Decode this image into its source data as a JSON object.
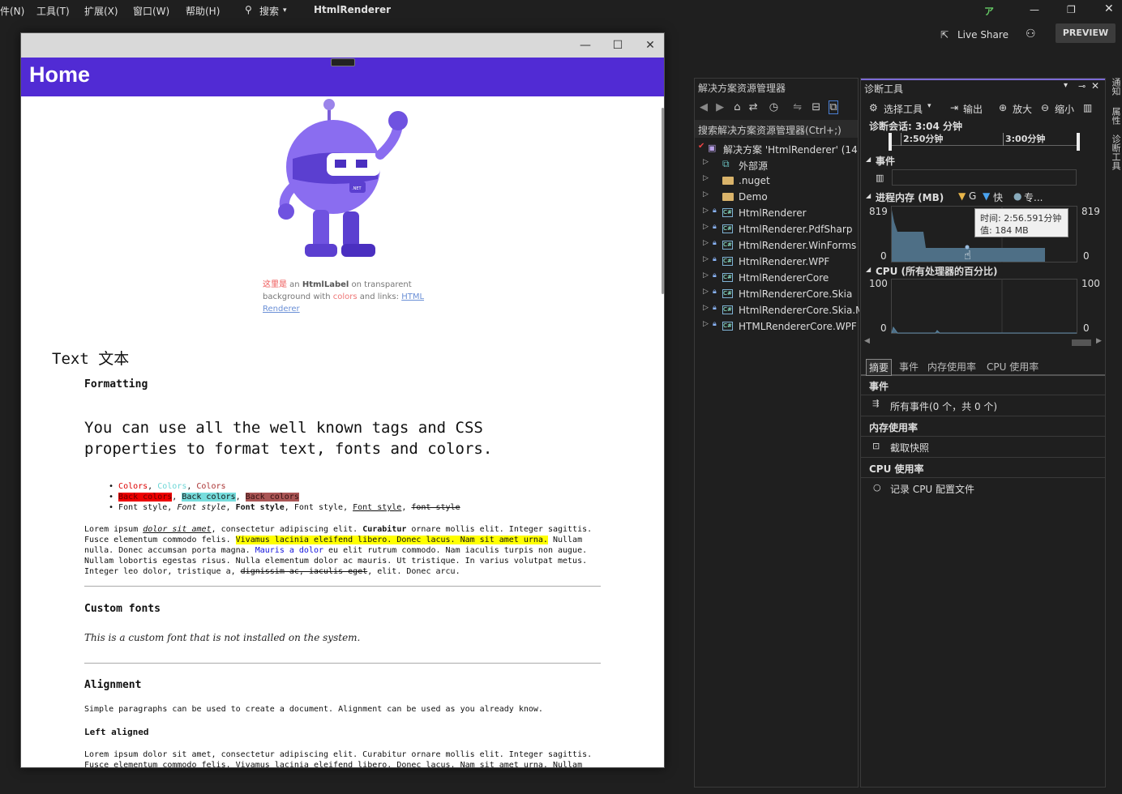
{
  "menubar": {
    "items": [
      "件(N)",
      "工具(T)",
      "扩展(X)",
      "窗口(W)",
      "帮助(H)"
    ],
    "search_label": "搜索",
    "solution_title": "HtmlRenderer",
    "live_share": "Live Share",
    "preview": "PREVIEW"
  },
  "app_window": {
    "header_title": "Home",
    "caption": {
      "colored_word": "这里是",
      "part1": " an ",
      "bold": "HtmlLabel",
      "part2": " on transparent",
      "part3": "background with ",
      "colors_word": "colors",
      "part4": " and links: ",
      "link": "HTML",
      "link2": "Renderer"
    },
    "section_text": "Text 文本",
    "formatting": "Formatting",
    "intro_line1": "You can use all the well known tags and CSS",
    "intro_line2": "properties to format text, fonts and colors.",
    "bullets": {
      "colors": [
        "Colors",
        "Colors",
        "Colors"
      ],
      "back_colors": [
        "Back colors",
        "Back colors",
        "Back colors"
      ],
      "font_styles": [
        "Font style",
        "Font style",
        "Font style",
        "Font style",
        "Font style",
        "font style"
      ]
    },
    "lorem": {
      "l1a": "Lorem ipsum ",
      "l1b": "dolor sit amet",
      "l1c": ", consectetur adipiscing elit. ",
      "l1d": "Curabitur",
      "l1e": " ornare mollis elit. Integer sagittis.",
      "l2a": "Fusce elementum commodo felis. ",
      "l2b": "Vivamus lacinia eleifend libero. Donec lacus. Nam sit amet urna.",
      "l2c": " Nullam",
      "l3a": "nulla. Donec accumsan porta magna. ",
      "l3b": "Mauris a dolor",
      "l3c": " eu elit rutrum commodo. Nam iaculis turpis non augue.",
      "l4": "Nullam lobortis egestas risus. Nulla elementum dolor ac mauris. Ut tristique. In varius volutpat metus.",
      "l5a": "Integer leo dolor, tristique a, ",
      "l5b": "dignissim ac, iaculis eget",
      "l5c": ", elit. Donec arcu."
    },
    "custom_fonts": "Custom fonts",
    "custom_font_sample": "This is a custom font that is not installed on the system.",
    "alignment": "Alignment",
    "alignment_desc": "Simple paragraphs can be used to create a document. Alignment can be used as you already know.",
    "left_aligned": "Left aligned",
    "lorem2_l1": "Lorem ipsum dolor sit amet, consectetur adipiscing elit. Curabitur ornare mollis elit. Integer sagittis.",
    "lorem2_l2": "Fusce elementum commodo felis. Vivamus lacinia eleifend libero. Donec lacus. Nam sit amet urna. Nullam"
  },
  "solution_explorer": {
    "title": "解决方案资源管理器",
    "search_placeholder": "搜索解决方案资源管理器(Ctrl+;)",
    "root": "解决方案 'HtmlRenderer' (14",
    "items": [
      {
        "label": "外部源",
        "type": "folder-ext"
      },
      {
        "label": ".nuget",
        "type": "folder"
      },
      {
        "label": "Demo",
        "type": "folder"
      },
      {
        "label": "HtmlRenderer",
        "type": "csproj"
      },
      {
        "label": "HtmlRenderer.PdfSharp",
        "type": "csproj"
      },
      {
        "label": "HtmlRenderer.WinForms",
        "type": "csproj"
      },
      {
        "label": "HtmlRenderer.WPF",
        "type": "csproj"
      },
      {
        "label": "HtmlRendererCore",
        "type": "csproj"
      },
      {
        "label": "HtmlRendererCore.Skia",
        "type": "csproj"
      },
      {
        "label": "HtmlRendererCore.Skia.M",
        "type": "csproj"
      },
      {
        "label": "HTMLRendererCore.WPF",
        "type": "csproj"
      }
    ]
  },
  "diagnostics": {
    "title": "诊断工具",
    "select_tools": "选择工具",
    "output": "输出",
    "zoom_in": "放大",
    "zoom_out": "缩小",
    "session": "诊断会话: 3:04 分钟",
    "timeline_marks": [
      "2:50分钟",
      "3:00分钟"
    ],
    "events_label": "事件",
    "memory_label": "进程内存 (MB)",
    "memory_legend": [
      "G",
      "快",
      "专..."
    ],
    "memory_max": "819",
    "memory_min": "0",
    "tooltip_time": "时间: 2:56.591分钟",
    "tooltip_value": "值: 184 MB",
    "cpu_label": "CPU (所有处理器的百分比)",
    "cpu_max": "100",
    "cpu_min": "0",
    "tabs": [
      "摘要",
      "事件",
      "内存使用率",
      "CPU 使用率"
    ],
    "sections": {
      "events": "事件",
      "all_events": "所有事件(0 个，共 0 个)",
      "memory": "内存使用率",
      "snapshot": "截取快照",
      "cpu": "CPU 使用率",
      "record_cpu": "记录 CPU 配置文件"
    }
  },
  "right_strip": [
    "通知",
    "属性",
    "诊断工具"
  ],
  "colors": {
    "accent": "#512bd4",
    "vs_bg": "#1f1f1f",
    "memory_fill": "#4e6f86",
    "highlight_yellow": "#ffff00"
  }
}
